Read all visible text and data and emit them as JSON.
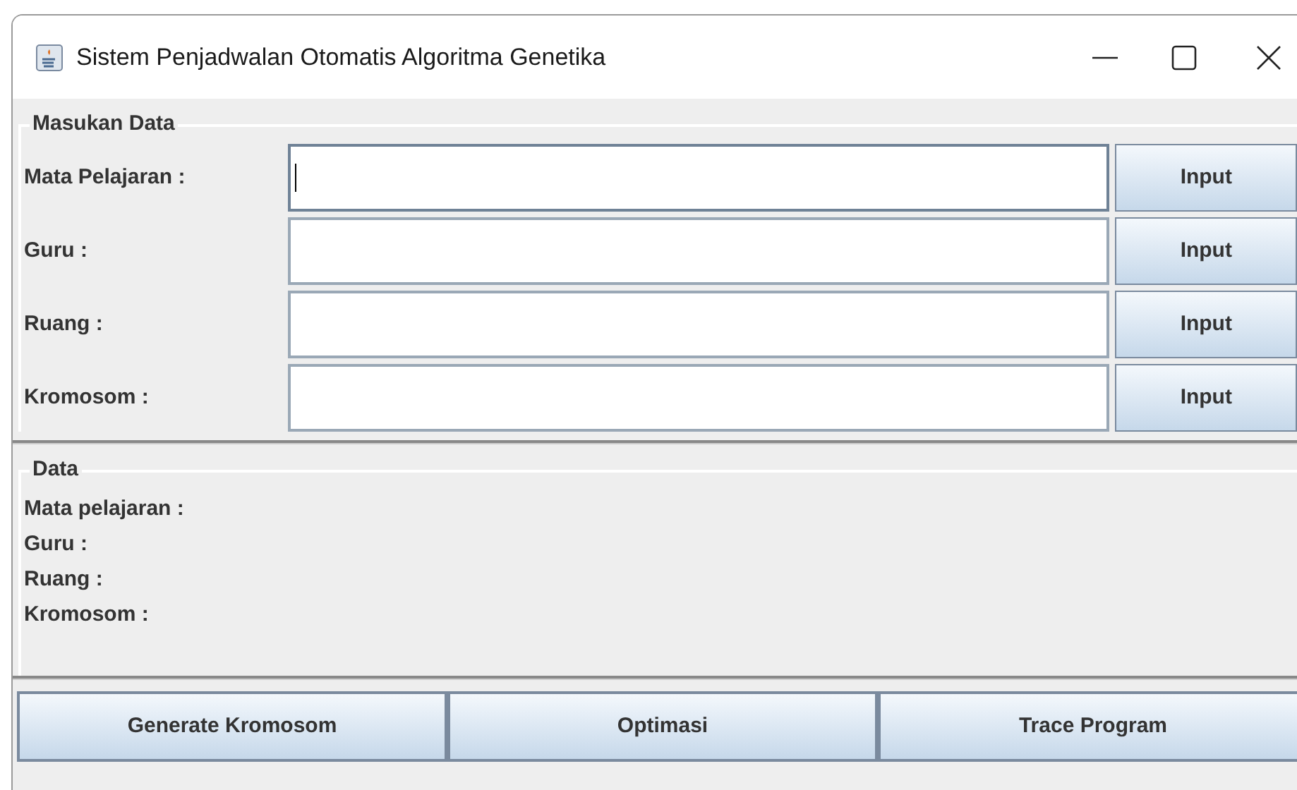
{
  "window": {
    "title": "Sistem Penjadwalan Otomatis Algoritma Genetika"
  },
  "input_panel": {
    "title": "Masukan Data",
    "rows": [
      {
        "label": "Mata Pelajaran :",
        "focused": true,
        "button": "Input"
      },
      {
        "label": "Guru :",
        "focused": false,
        "button": "Input"
      },
      {
        "label": "Ruang :",
        "focused": false,
        "button": "Input"
      },
      {
        "label": "Kromosom :",
        "focused": false,
        "button": "Input"
      }
    ]
  },
  "data_panel": {
    "title": "Data",
    "lines": [
      "Mata pelajaran :",
      "Guru :",
      "Ruang :",
      "Kromosom :"
    ]
  },
  "buttons": [
    "Generate Kromosom",
    "Optimasi",
    "Trace Program"
  ]
}
